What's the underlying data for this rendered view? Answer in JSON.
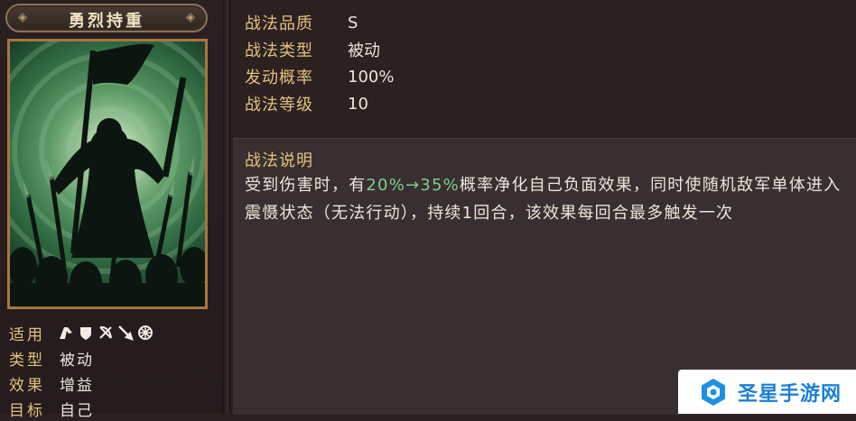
{
  "skill": {
    "name": "勇烈持重"
  },
  "tags": {
    "applicable_label": "适用",
    "type_label": "类型",
    "type_value": "被动",
    "effect_label": "效果",
    "effect_value": "增益",
    "target_label": "目标",
    "target_value": "自己",
    "unit_icons": [
      "cavalry-icon",
      "shield-icon",
      "bow-icon",
      "spear-icon",
      "wheel-icon"
    ]
  },
  "attributes": [
    {
      "label": "战法品质",
      "value": "S"
    },
    {
      "label": "战法类型",
      "value": "被动"
    },
    {
      "label": "发动概率",
      "value": "100%"
    },
    {
      "label": "战法等级",
      "value": "10"
    }
  ],
  "description": {
    "title": "战法说明",
    "text_before": "受到伤害时，有",
    "highlight": "20%→35%",
    "text_after": "概率净化自己负面效果，同时使随机敌军单体进入震慑状态（无法行动），持续1回合，该效果每回合最多触发一次",
    "highlight_color": "#7bd08c"
  },
  "watermark": {
    "text": "圣星手游网",
    "color": "#1c7fd6"
  }
}
